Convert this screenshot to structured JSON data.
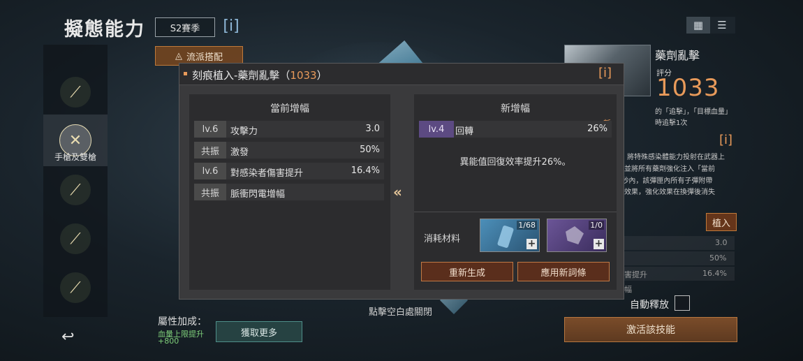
{
  "header": {
    "title": "擬態能力",
    "season": "S2賽季",
    "info_icon": "i",
    "view_grid_icon": "▦",
    "view_list_icon": "☰"
  },
  "sidebar": {
    "active_label": "手槍及雙槍",
    "back_icon": "↩"
  },
  "left": {
    "loadout_button": "流派搭配",
    "attr_title": "屬性加成：",
    "attr_line1": "血量上限提升",
    "attr_line2": "+800",
    "get_more_button": "獲取更多",
    "dismiss_hint": "點擊空白處關閉"
  },
  "right": {
    "skill_name": "藥劑亂擊",
    "score_label": "評分",
    "score_value": "1033",
    "desc_lines": [
      "的「追擊」，「目標血量」",
      "時追擊1次",
      "將特殊感染體能力投射在武器上",
      "彈並將所有藥劑強化注入「當前",
      "0秒內，該彈匣內所有子彈附帶",
      "化效果，強化效果在換彈後消失"
    ],
    "implant_button": "植入",
    "values": [
      "3.0",
      "50%",
      "16.4%"
    ],
    "row_fragments": [
      "害提升",
      "幅"
    ],
    "auto_release_label": "自動釋放",
    "activate_button": "激活該技能"
  },
  "modal": {
    "title": "刻痕植入-藥劑亂擊（",
    "title_score": "1033",
    "title_end": "）",
    "info_icon": "[i]",
    "current_heading": "當前增幅",
    "new_heading": "新增幅",
    "current_stats": [
      {
        "tag": "lv.6",
        "name": "攻擊力",
        "value": "3.0"
      },
      {
        "tag": "共振",
        "name": "激發",
        "value": "50%"
      },
      {
        "tag": "lv.6",
        "name": "對感染者傷害提升",
        "value": "16.4%"
      },
      {
        "tag": "共振",
        "name": "脈衝閃電增幅",
        "value": ""
      }
    ],
    "new_stat": {
      "tag": "lv.4",
      "name": "回轉",
      "value": "26%"
    },
    "new_badge": "新",
    "new_desc": "異能值回復效率提升26%。",
    "arrow": "«",
    "materials_label": "消耗材料",
    "material_counts": [
      "1/68",
      "1/0"
    ],
    "regen_button": "重新生成",
    "apply_button": "應用新詞條"
  }
}
